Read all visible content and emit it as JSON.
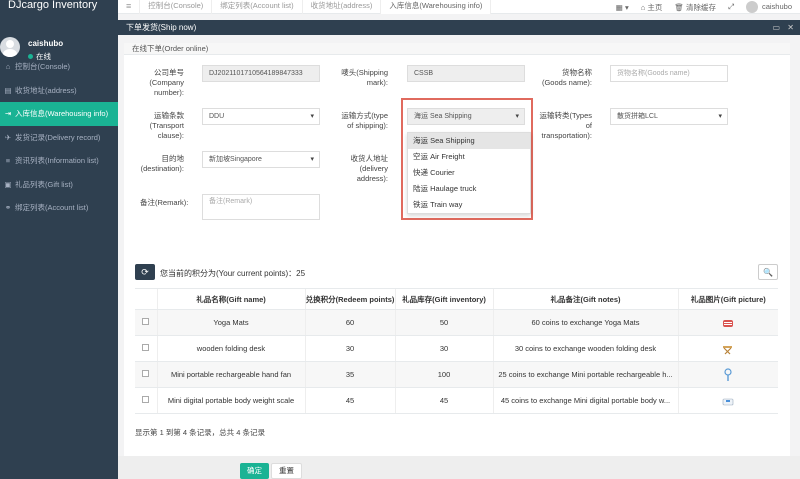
{
  "app": {
    "brand": "DJcargo Inventory",
    "user": "caishubo",
    "status": "在线"
  },
  "sidebar": {
    "items": [
      {
        "icon": "home-icon",
        "glyph": "⌂",
        "label": "控制台(Console)"
      },
      {
        "icon": "truck-icon",
        "glyph": "▤",
        "label": "收货地址(address)"
      },
      {
        "icon": "login-icon",
        "glyph": "⇥",
        "label": "入库信息(Warehousing info)"
      },
      {
        "icon": "send-icon",
        "glyph": "✈",
        "label": "发货记录(Delivery record)"
      },
      {
        "icon": "list-icon",
        "glyph": "≡",
        "label": "资讯列表(Information list)"
      },
      {
        "icon": "gift-icon",
        "glyph": "▣",
        "label": "礼品列表(Gift list)"
      },
      {
        "icon": "link-icon",
        "glyph": "⚭",
        "label": "绑定列表(Account list)"
      }
    ]
  },
  "topbar": {
    "menu_glyph": "≡",
    "tabs": [
      "控制台(Console)",
      "绑定列表(Account list)",
      "收货地址(address)",
      "入库信息(Warehousing info)"
    ],
    "grid_label": "▦ ▾",
    "home": "⌂ 主页",
    "clear": "🗑 清除缓存",
    "fullscreen": "⤢",
    "user": "caishubo"
  },
  "panel": {
    "title": "下单发货(Ship now)",
    "maximize": "▭",
    "close": "✕",
    "section": "在线下单(Order online)"
  },
  "form": {
    "company_no_label": "公司单号\n(Company\nnumber):",
    "company_no": "DJ2021101710564189847333",
    "mark_label": "唛头(Shipping\nmark):",
    "mark": "CSSB",
    "goods_label": "货物名称\n(Goods name):",
    "goods_placeholder": "货物名称(Goods name)",
    "clause_label": "运输条款\n(Transport\nclause):",
    "clause": "DDU",
    "ship_label": "运输方式(type\nof shipping):",
    "ship": "海运 Sea Shipping",
    "trans_label": "运输转类(Types\nof\ntransportation):",
    "trans": "散货拼箱LCL",
    "dest_label": "目的地\n(destination):",
    "dest": "新加坡Singapore",
    "addr_label": "收货人地址\n(delivery\naddress):",
    "remark_label": "备注(Remark):",
    "remark_placeholder": "备注(Remark)",
    "ship_options": [
      "海运 Sea Shipping",
      "空运 Air Freight",
      "快递 Courier",
      "陆运 Haulage truck",
      "铁运 Train way"
    ]
  },
  "points": {
    "refresh": "⟳",
    "label": "您当前的积分为(Your current points)：25",
    "search": "🔍"
  },
  "table": {
    "headers": [
      "礼品名称(Gift name)",
      "兑换积分(Redeem points)",
      "礼品库存(Gift inventory)",
      "礼品备注(Gift notes)",
      "礼品图片(Gift picture)"
    ],
    "rows": [
      {
        "name": "Yoga Mats",
        "points": "60",
        "inventory": "50",
        "notes": "60 coins to exchange Yoga Mats",
        "icon": "yoga-mat-icon"
      },
      {
        "name": "wooden folding desk",
        "points": "30",
        "inventory": "30",
        "notes": "30 coins to exchange wooden folding desk",
        "icon": "desk-icon"
      },
      {
        "name": "Mini portable rechargeable hand fan",
        "points": "35",
        "inventory": "100",
        "notes": "25 coins to exchange Mini portable rechargeable h...",
        "icon": "fan-icon"
      },
      {
        "name": "Mini digital portable body weight scale",
        "points": "45",
        "inventory": "45",
        "notes": "45 coins to exchange Mini digital portable body w...",
        "icon": "scale-icon"
      }
    ],
    "info": "显示第 1 到第 4 条记录，总共 4 条记录"
  },
  "footer": {
    "ok": "确定",
    "reset": "重置"
  }
}
